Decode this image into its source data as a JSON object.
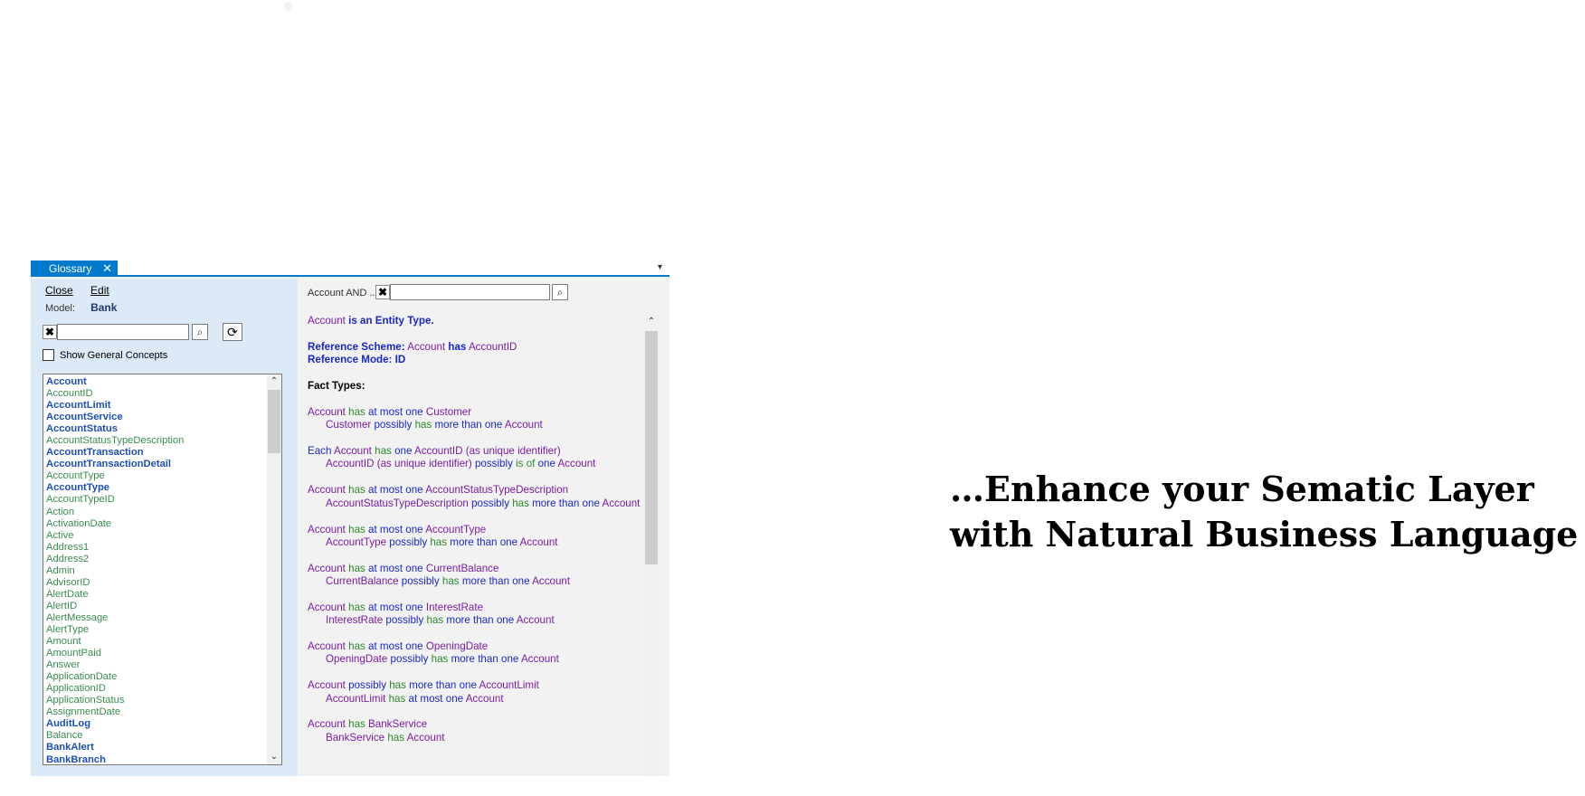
{
  "tab": {
    "label": "Glossary",
    "close_glyph": "✕",
    "dropdown_glyph": "▾"
  },
  "menu": {
    "close": "Close",
    "edit": "Edit"
  },
  "model": {
    "label": "Model:",
    "value": "Bank"
  },
  "search": {
    "clear_glyph": "✖",
    "search_glyph": "⌕",
    "refresh_glyph": "⟳"
  },
  "show_general": "Show General Concepts",
  "glossary_items": [
    {
      "t": "Account",
      "s": "b"
    },
    {
      "t": "AccountID",
      "s": "g"
    },
    {
      "t": "AccountLimit",
      "s": "b"
    },
    {
      "t": "AccountService",
      "s": "b"
    },
    {
      "t": "AccountStatus",
      "s": "b"
    },
    {
      "t": "AccountStatusTypeDescription",
      "s": "g"
    },
    {
      "t": "AccountTransaction",
      "s": "b"
    },
    {
      "t": "AccountTransactionDetail",
      "s": "b"
    },
    {
      "t": "AccountType",
      "s": "g"
    },
    {
      "t": "AccountType",
      "s": "b"
    },
    {
      "t": "AccountTypeID",
      "s": "g"
    },
    {
      "t": "Action",
      "s": "g"
    },
    {
      "t": "ActivationDate",
      "s": "g"
    },
    {
      "t": "Active",
      "s": "g"
    },
    {
      "t": "Address1",
      "s": "g"
    },
    {
      "t": "Address2",
      "s": "g"
    },
    {
      "t": "Admin",
      "s": "g"
    },
    {
      "t": "AdvisorID",
      "s": "g"
    },
    {
      "t": "AlertDate",
      "s": "g"
    },
    {
      "t": "AlertID",
      "s": "g"
    },
    {
      "t": "AlertMessage",
      "s": "g"
    },
    {
      "t": "AlertType",
      "s": "g"
    },
    {
      "t": "Amount",
      "s": "g"
    },
    {
      "t": "AmountPaid",
      "s": "g"
    },
    {
      "t": "Answer",
      "s": "g"
    },
    {
      "t": "ApplicationDate",
      "s": "g"
    },
    {
      "t": "ApplicationID",
      "s": "g"
    },
    {
      "t": "ApplicationStatus",
      "s": "g"
    },
    {
      "t": "AssignmentDate",
      "s": "g"
    },
    {
      "t": "AuditLog",
      "s": "b"
    },
    {
      "t": "Balance",
      "s": "g"
    },
    {
      "t": "BankAlert",
      "s": "b"
    },
    {
      "t": "BankBranch",
      "s": "b"
    }
  ],
  "right_header": "Account AND ...",
  "entity_line": {
    "name": "Account",
    "text": "is an Entity Type."
  },
  "ref_scheme": {
    "label": "Reference Scheme:",
    "a": "Account",
    "has": "has",
    "b": "AccountID"
  },
  "ref_mode": "Reference Mode: ID",
  "fact_types_heading": "Fact Types:",
  "fact_types": [
    [
      [
        [
          "Account",
          "p"
        ],
        [
          " has ",
          "g"
        ],
        [
          "at most one ",
          "b"
        ],
        [
          "Customer",
          "p"
        ]
      ],
      [
        [
          "Customer ",
          "p"
        ],
        [
          "possibly ",
          "b"
        ],
        [
          "has ",
          "g"
        ],
        [
          "more than one ",
          "b"
        ],
        [
          "Account",
          "p"
        ]
      ]
    ],
    [
      [
        [
          "Each ",
          "b"
        ],
        [
          "Account ",
          "p"
        ],
        [
          "has ",
          "g"
        ],
        [
          "one ",
          "b"
        ],
        [
          "AccountID (as unique identifier)",
          "p"
        ]
      ],
      [
        [
          "AccountID (as unique identifier) ",
          "p"
        ],
        [
          "possibly ",
          "b"
        ],
        [
          "is of ",
          "g"
        ],
        [
          "one ",
          "b"
        ],
        [
          "Account",
          "p"
        ]
      ]
    ],
    [
      [
        [
          "Account",
          "p"
        ],
        [
          " has ",
          "g"
        ],
        [
          "at most one ",
          "b"
        ],
        [
          "AccountStatusTypeDescription",
          "p"
        ]
      ],
      [
        [
          "AccountStatusTypeDescription ",
          "p"
        ],
        [
          "possibly ",
          "b"
        ],
        [
          "has ",
          "g"
        ],
        [
          "more than one ",
          "b"
        ],
        [
          "Account",
          "p"
        ]
      ]
    ],
    [
      [
        [
          "Account",
          "p"
        ],
        [
          " has ",
          "g"
        ],
        [
          "at most one ",
          "b"
        ],
        [
          "AccountType",
          "p"
        ]
      ],
      [
        [
          "AccountType ",
          "p"
        ],
        [
          "possibly ",
          "b"
        ],
        [
          "has ",
          "g"
        ],
        [
          "more than one ",
          "b"
        ],
        [
          "Account",
          "p"
        ]
      ]
    ],
    [
      [
        [
          "Account",
          "p"
        ],
        [
          " has ",
          "g"
        ],
        [
          "at most one ",
          "b"
        ],
        [
          "CurrentBalance",
          "p"
        ]
      ],
      [
        [
          "CurrentBalance ",
          "p"
        ],
        [
          "possibly ",
          "b"
        ],
        [
          "has ",
          "g"
        ],
        [
          "more than one ",
          "b"
        ],
        [
          "Account",
          "p"
        ]
      ]
    ],
    [
      [
        [
          "Account",
          "p"
        ],
        [
          " has ",
          "g"
        ],
        [
          "at most one ",
          "b"
        ],
        [
          "InterestRate",
          "p"
        ]
      ],
      [
        [
          "InterestRate ",
          "p"
        ],
        [
          "possibly ",
          "b"
        ],
        [
          "has ",
          "g"
        ],
        [
          "more than one ",
          "b"
        ],
        [
          "Account",
          "p"
        ]
      ]
    ],
    [
      [
        [
          "Account",
          "p"
        ],
        [
          " has ",
          "g"
        ],
        [
          "at most one ",
          "b"
        ],
        [
          "OpeningDate",
          "p"
        ]
      ],
      [
        [
          "OpeningDate ",
          "p"
        ],
        [
          "possibly ",
          "b"
        ],
        [
          "has ",
          "g"
        ],
        [
          "more than one ",
          "b"
        ],
        [
          "Account",
          "p"
        ]
      ]
    ],
    [
      [
        [
          "Account ",
          "p"
        ],
        [
          "possibly ",
          "b"
        ],
        [
          "has ",
          "g"
        ],
        [
          "more than one ",
          "b"
        ],
        [
          "AccountLimit",
          "p"
        ]
      ],
      [
        [
          "AccountLimit ",
          "p"
        ],
        [
          "has ",
          "g"
        ],
        [
          "at most one ",
          "b"
        ],
        [
          "Account",
          "p"
        ]
      ]
    ],
    [
      [
        [
          "Account",
          "p"
        ],
        [
          " has ",
          "g"
        ],
        [
          "BankService",
          "p"
        ]
      ],
      [
        [
          "BankService ",
          "p"
        ],
        [
          "has ",
          "g"
        ],
        [
          "Account",
          "p"
        ]
      ]
    ]
  ],
  "tagline": {
    "line1": "…Enhance your Sematic Layer",
    "line2": "with Natural Business Language"
  },
  "colors": {
    "tab_blue": "#007acc",
    "panel_left": "#dce9f7",
    "entity": "#7a1ea1",
    "verb": "#2a8a2a",
    "quantifier": "#1a28c8"
  }
}
